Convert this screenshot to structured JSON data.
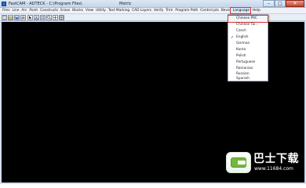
{
  "window": {
    "title": "FastCAM - ADTECK - C:\\Program Files\\",
    "center_title": "Metric",
    "minimize_glyph": "–",
    "maximize_glyph": "□",
    "close_glyph": "✕"
  },
  "menu": {
    "items": [
      "Files",
      "Line",
      "Arc",
      "Point",
      "Constructs",
      "Erase",
      "Blocks",
      "View",
      "Utility",
      "Text Marking",
      "CAD Layers",
      "Verify",
      "Trim",
      "Program Path",
      "Control pts",
      "Bevel",
      "Language",
      "Help"
    ],
    "active_index": 16
  },
  "toolbar": {
    "buttons": [
      "new-icon",
      "open-icon",
      "save-icon",
      "print-icon",
      "select-icon",
      "cut-icon",
      "grid-icon",
      "zoom-icon",
      "pan-icon",
      "fit-icon"
    ]
  },
  "language_menu": {
    "items": [
      "Chinese PRC",
      "Chinese Tai...",
      "Czech",
      "English",
      "German",
      "Korea",
      "Polish",
      "Portuguese",
      "Romanian",
      "Russian",
      "Spanish"
    ],
    "checked_index": 3,
    "highlighted_index": 0,
    "check_glyph": "✓"
  },
  "watermark": {
    "name": "巴士下载",
    "url": "www.11684.com"
  },
  "colors": {
    "canvas": "#000000",
    "highlight": "#e03030",
    "logo_green": "#72b83a"
  }
}
